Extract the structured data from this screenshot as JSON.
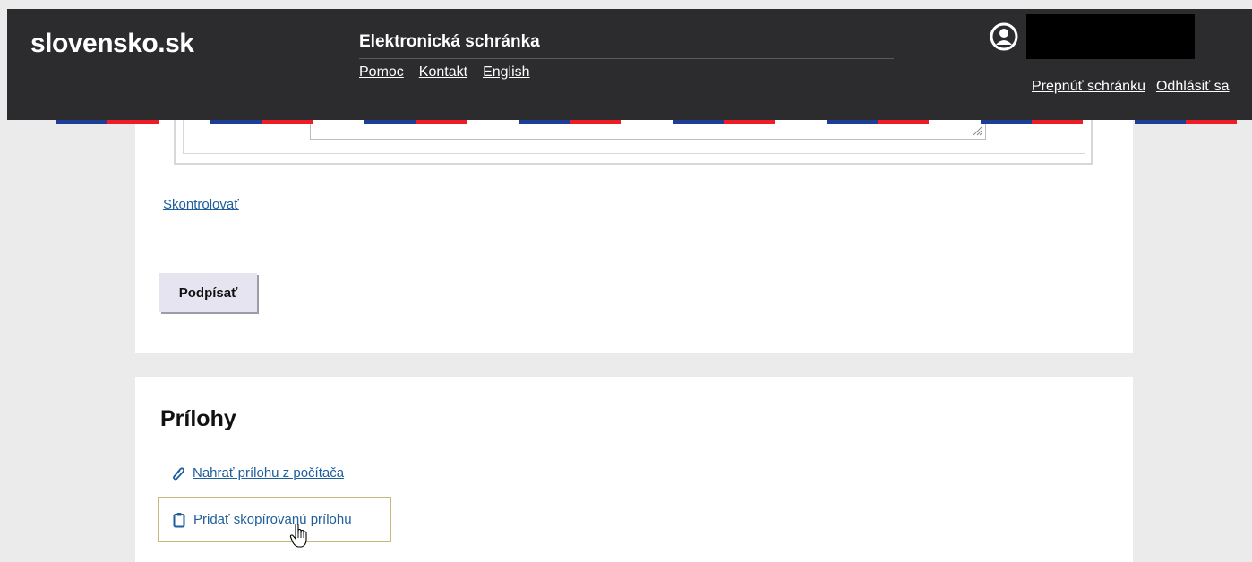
{
  "header": {
    "logo": "slovensko.sk",
    "service_title": "Elektronická schránka",
    "links": [
      "Pomoc",
      "Kontakt",
      "English"
    ],
    "user_icon": "user-circle-icon",
    "account_links": [
      "Prepnúť schránku",
      "Odhlásiť sa"
    ],
    "flag_colors": [
      "#1c3f95",
      "#ee1c25"
    ]
  },
  "form": {
    "check_link": "Skontrolovať",
    "sign_button": "Podpísať"
  },
  "attachments": {
    "heading": "Prílohy",
    "upload_link": "Nahrať prílohu z počítača",
    "upload_icon": "paperclip-icon",
    "paste_link": "Pridať skopírovanú prílohu",
    "paste_icon": "clipboard-icon"
  },
  "colors": {
    "header_bg": "#2c2b2d",
    "link": "#1f5e9b",
    "focus_outline": "#c9b87a",
    "button_bg": "#e6e4f1"
  }
}
